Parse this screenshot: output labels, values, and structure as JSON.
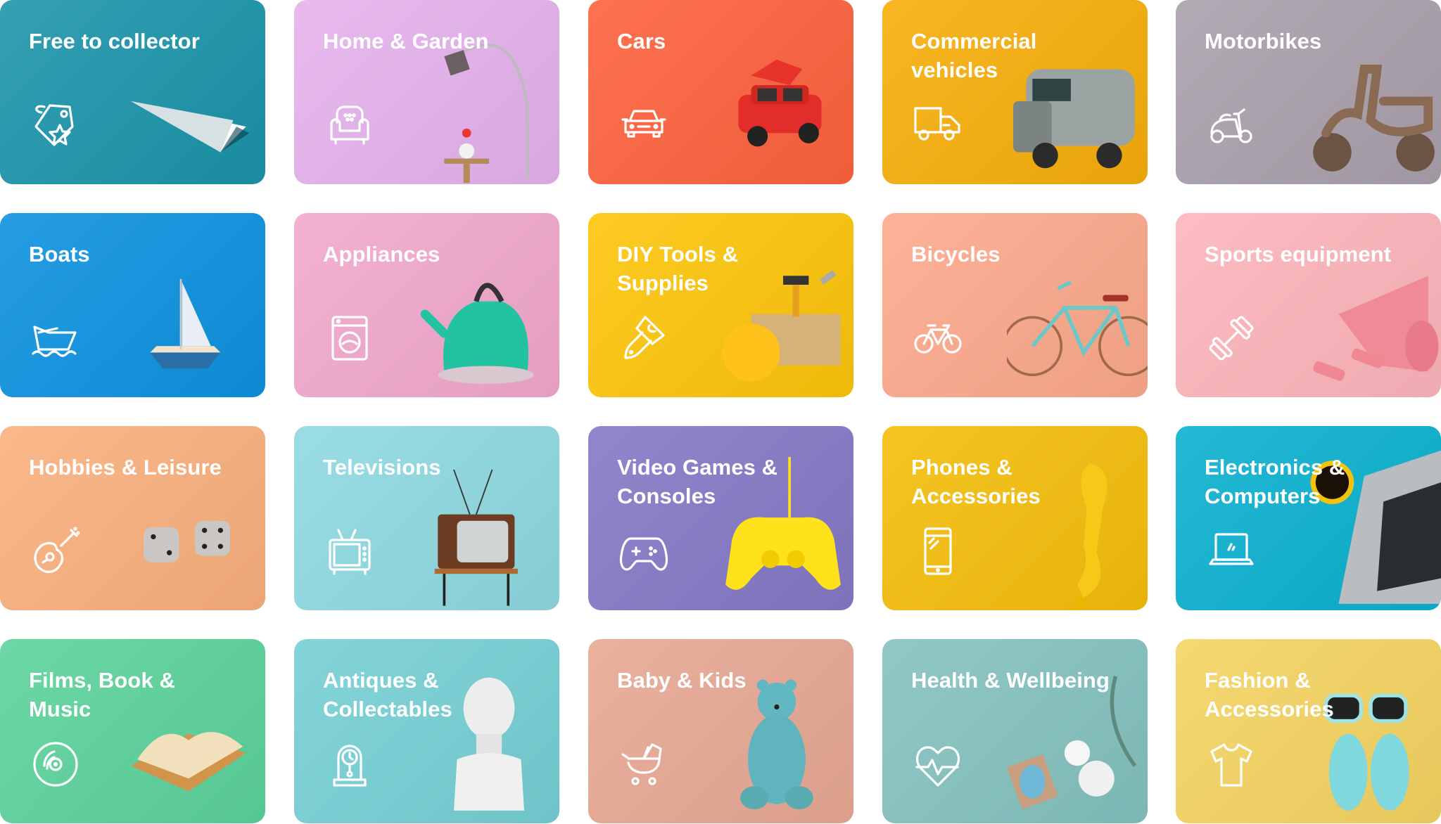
{
  "categories": [
    {
      "label": "Free to collector",
      "icon": "tag-star-icon",
      "photo": "paper-plane",
      "color": "#1A8EA3"
    },
    {
      "label": "Home & Garden",
      "icon": "armchair-icon",
      "photo": "floor-lamp",
      "color": "#E5B2EC"
    },
    {
      "label": "Cars",
      "icon": "car-icon",
      "photo": "toy-car",
      "color": "#FE623D"
    },
    {
      "label": "Commercial vehicles",
      "icon": "van-icon",
      "photo": "vintage-van",
      "color": "#F7AE0A"
    },
    {
      "label": "Motorbikes",
      "icon": "scooter-icon",
      "photo": "scooter",
      "color": "#A9A0AB"
    },
    {
      "label": "Boats",
      "icon": "boat-icon",
      "photo": "toy-sailboat",
      "color": "#0D92E0"
    },
    {
      "label": "Appliances",
      "icon": "washing-machine-icon",
      "photo": "kettle",
      "color": "#F2A8CC"
    },
    {
      "label": "DIY Tools & Supplies",
      "icon": "paintbrush-icon",
      "photo": "toolbox",
      "color": "#FDC50A"
    },
    {
      "label": "Bicycles",
      "icon": "bicycle-icon",
      "photo": "bicycle",
      "color": "#FDA98C"
    },
    {
      "label": "Sports equipment",
      "icon": "dumbbell-icon",
      "photo": "yoga-mat",
      "color": "#FDB5BB"
    },
    {
      "label": "Hobbies & Leisure",
      "icon": "guitar-icon",
      "photo": "dice",
      "color": "#FAB07D"
    },
    {
      "label": "Televisions",
      "icon": "tv-icon",
      "photo": "retro-tv",
      "color": "#8FD9E1"
    },
    {
      "label": "Video Games & Consoles",
      "icon": "gamepad-icon",
      "photo": "game-controller",
      "color": "#8579C6"
    },
    {
      "label": "Phones & Accessories",
      "icon": "mobile-phone-icon",
      "photo": "telephone-handset",
      "color": "#F5BE0B"
    },
    {
      "label": "Electronics & Computers",
      "icon": "laptop-icon",
      "photo": "laptop-coffee",
      "color": "#0BB1D0"
    },
    {
      "label": "Films, Book & Music",
      "icon": "vinyl-disc-icon",
      "photo": "open-book",
      "color": "#5CD39B"
    },
    {
      "label": "Antiques & Collectables",
      "icon": "clock-icon",
      "photo": "bust-statue",
      "color": "#76D0D5"
    },
    {
      "label": "Baby & Kids",
      "icon": "pram-icon",
      "photo": "teddy-bear",
      "color": "#E8A894"
    },
    {
      "label": "Health & Wellbeing",
      "icon": "heart-pulse-icon",
      "photo": "spa-items",
      "color": "#84C2BF"
    },
    {
      "label": "Fashion & Accessories",
      "icon": "tshirt-icon",
      "photo": "sunglasses-flipflops",
      "color": "#F5D462"
    }
  ]
}
